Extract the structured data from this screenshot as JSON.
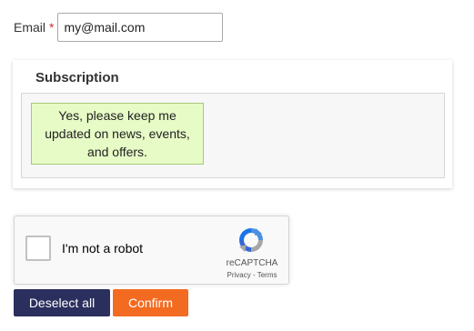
{
  "email": {
    "label": "Email",
    "required_marker": "*",
    "value": "my@mail.com"
  },
  "subscription": {
    "title": "Subscription",
    "option_text": "Yes, please keep me updated on news, events, and offers.",
    "option_selected_color": "#e6fbc6"
  },
  "recaptcha": {
    "label": "I'm not a robot",
    "brand": "reCAPTCHA",
    "privacy_link": "Privacy",
    "separator": " - ",
    "terms_link": "Terms",
    "checked": false,
    "icon": "recaptcha-logo-icon"
  },
  "buttons": {
    "deselect_label": "Deselect all",
    "deselect_color": "#2a2f5e",
    "confirm_label": "Confirm",
    "confirm_color": "#f26b21"
  }
}
